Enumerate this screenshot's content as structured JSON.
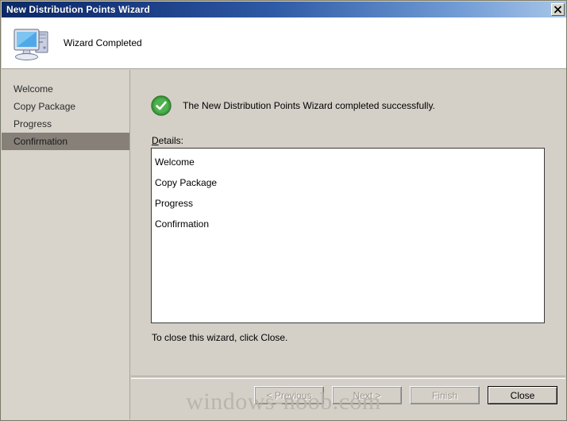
{
  "window": {
    "title": "New Distribution Points Wizard",
    "close_icon": "close-icon"
  },
  "header": {
    "icon": "computer-icon",
    "title": "Wizard Completed"
  },
  "sidebar": {
    "items": [
      {
        "label": "Welcome",
        "active": false
      },
      {
        "label": "Copy Package",
        "active": false
      },
      {
        "label": "Progress",
        "active": false
      },
      {
        "label": "Confirmation",
        "active": true
      }
    ]
  },
  "main": {
    "status_icon": "success-check-icon",
    "status_text": "The New Distribution Points Wizard completed successfully.",
    "details_label_accel": "D",
    "details_label_rest": "etails:",
    "details": [
      "Welcome",
      "Copy Package",
      "Progress",
      "Confirmation"
    ],
    "closing_text": "To close this wizard, click Close."
  },
  "footer": {
    "buttons": [
      {
        "label": "< Previous",
        "disabled": true,
        "default": false
      },
      {
        "label": "Next >",
        "disabled": true,
        "default": false
      },
      {
        "label": "Finish",
        "disabled": true,
        "default": false
      },
      {
        "label": "Close",
        "disabled": false,
        "default": true
      }
    ]
  },
  "watermark": {
    "text": "windows-noob.com"
  },
  "colors": {
    "titlebar_start": "#0c2a66",
    "titlebar_end": "#a8c6e8",
    "dialog_face": "#d4d0c8",
    "sidebar_face": "#d8d4cc",
    "sidebar_active": "#868078",
    "success_green": "#3f9f3f",
    "watermark_gray": "#b9b5ac"
  }
}
